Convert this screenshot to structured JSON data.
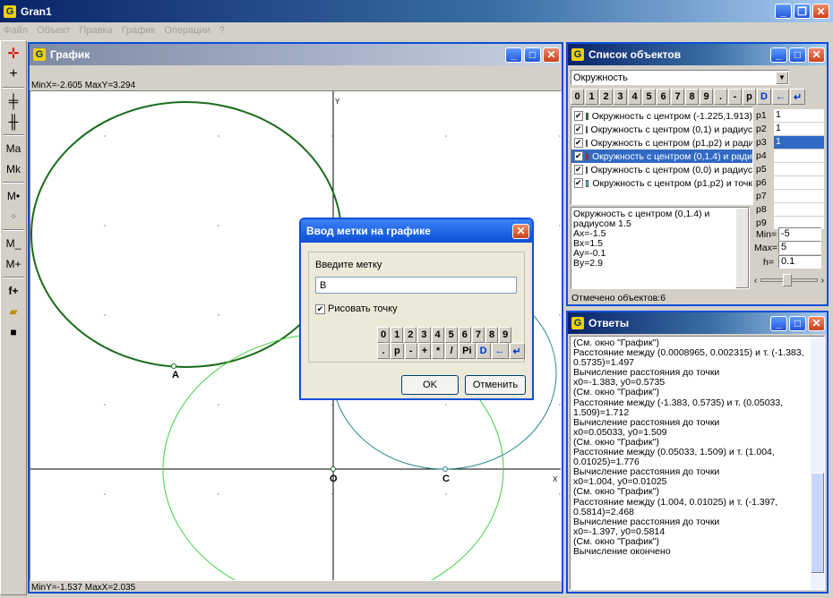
{
  "app": {
    "title": "Gran1",
    "menu": [
      "Файл",
      "Объект",
      "Правка",
      "График",
      "Операции",
      "?"
    ]
  },
  "toolbar": {
    "tools": [
      "red-plus-icon",
      "plus-icon",
      "cross-tick-icon",
      "cross-tick-alt-icon",
      "Ma",
      "Mk",
      "M•",
      "dots-icon",
      "M_",
      "M+",
      "f+",
      "open-folder-icon",
      "save-disk-icon"
    ]
  },
  "graph_window": {
    "title": "График",
    "range_top": "MinX=-2.605  MaxY=3.294",
    "range_bottom": "MinY=-1.537  MaxX=2.035",
    "axis_x_label": "X",
    "axis_y_label": "Y",
    "origin_label": "O",
    "point_labels": [
      "A",
      "C"
    ]
  },
  "objects_window": {
    "title": "Список объектов",
    "select_value": "Окружность",
    "keypad": [
      "0",
      "1",
      "2",
      "3",
      "4",
      "5",
      "6",
      "7",
      "8",
      "9",
      ".",
      "-",
      "p",
      "D",
      "←",
      "↵"
    ],
    "items": [
      {
        "label": "Окружность с центром (-1.225,1.913)",
        "color": "#1a6b1a",
        "selected": false
      },
      {
        "label": "Окружность с центром (0,1) и радиус",
        "color": "#800080",
        "selected": false
      },
      {
        "label": "Окружность с центром (p1,p2) и ради",
        "color": "#008080",
        "selected": false
      },
      {
        "label": "Окружность с центром (0,1.4) и ради",
        "color": "#ff0000",
        "selected": true
      },
      {
        "label": "Окружность с центром (0,0) и радиус",
        "color": "#00cc00",
        "selected": false
      },
      {
        "label": "Окружность с центром (p1,p2) и точк",
        "color": "#40e0e0",
        "selected": false
      }
    ],
    "params": [
      {
        "name": "p1",
        "value": "1",
        "selected": false
      },
      {
        "name": "p2",
        "value": "1",
        "selected": false
      },
      {
        "name": "p3",
        "value": "1",
        "selected": true
      },
      {
        "name": "p4",
        "value": "",
        "selected": false
      },
      {
        "name": "p5",
        "value": "",
        "selected": false
      },
      {
        "name": "p6",
        "value": "",
        "selected": false
      },
      {
        "name": "p7",
        "value": "",
        "selected": false
      },
      {
        "name": "p8",
        "value": "",
        "selected": false
      },
      {
        "name": "p9",
        "value": "",
        "selected": false
      }
    ],
    "description": [
      "Окружность с центром (0,1.4) и",
      "радиусом 1.5",
      "Ax=-1.5",
      "Bx=1.5",
      "Ay=-0.1",
      "By=2.9"
    ],
    "min_label": "Min=",
    "min_value": "-5",
    "max_label": "Max=",
    "max_value": "5",
    "h_label": "h=",
    "h_value": "0.1",
    "status": "Отмечено объектов:6"
  },
  "answers_window": {
    "title": "Ответы",
    "lines": [
      "(См. окно \"График\")",
      "Расстояние между (0.0008965, 0.002315) и т. (-1.383,",
      "0.5735)=1.497",
      "Вычисление расстояния до точки",
      "x0=-1.383, y0=0.5735",
      "(См. окно \"График\")",
      "Расстояние между (-1.383, 0.5735) и т. (0.05033,",
      "1.509)=1.712",
      "Вычисление расстояния до точки",
      "x0=0.05033, y0=1.509",
      "(См. окно \"График\")",
      "Расстояние между (0.05033, 1.509) и т. (1.004,",
      "0.01025)=1.776",
      "Вычисление расстояния до точки",
      "x0=1.004, y0=0.01025",
      "(См. окно \"График\")",
      "Расстояние между (1.004, 0.01025) и т. (-1.397,",
      "0.5814)=2.468",
      "Вычисление расстояния до точки",
      "x0=-1.397, y0=0.5814",
      "(См. окно \"График\")",
      "Вычисление окончено"
    ]
  },
  "dialog": {
    "title": "Ввод метки на графике",
    "prompt": "Введите метку",
    "input_value": "B",
    "checkbox_label": "Рисовать точку",
    "checkbox_checked": true,
    "keypad_row1": [
      "0",
      "1",
      "2",
      "3",
      "4",
      "5",
      "6",
      "7",
      "8",
      "9"
    ],
    "keypad_row2": [
      ".",
      "p",
      "-",
      "+",
      "*",
      "/",
      "Pi",
      "D",
      "←",
      "↵"
    ],
    "ok_label": "OK",
    "cancel_label": "Отменить"
  }
}
